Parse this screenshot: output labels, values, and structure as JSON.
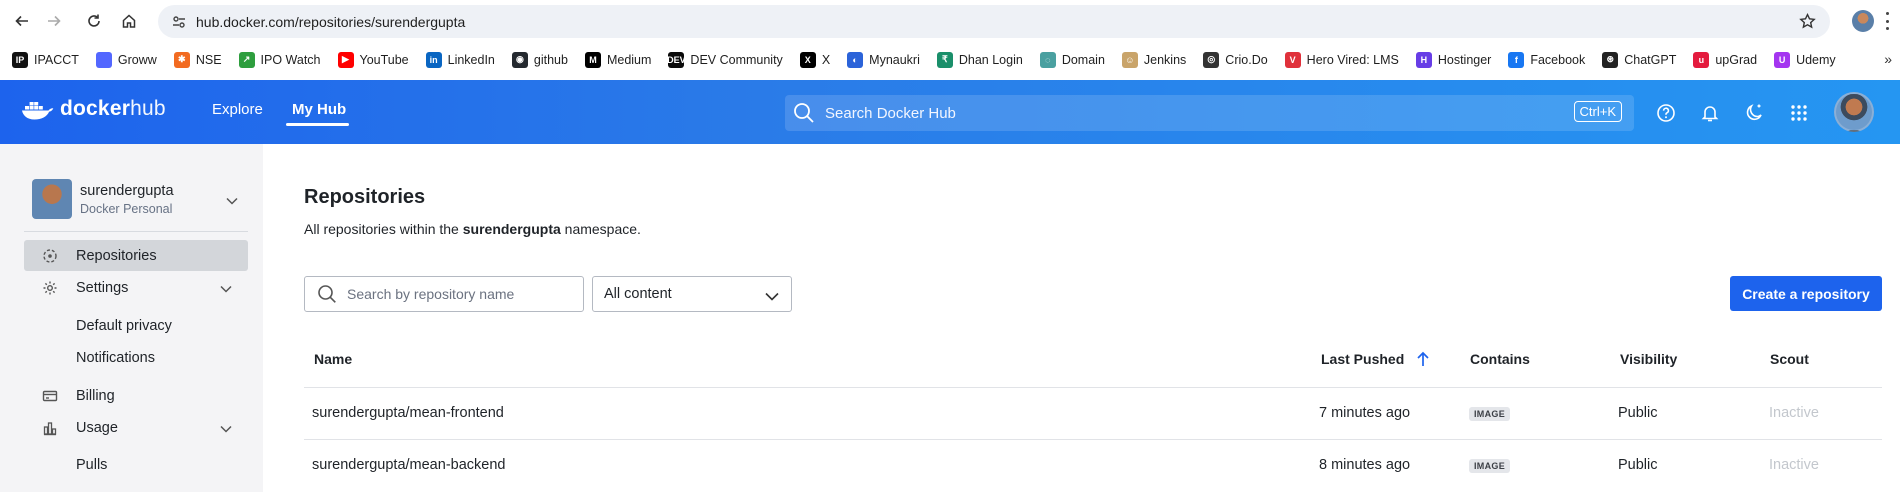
{
  "browser": {
    "url": "hub.docker.com/repositories/surendergupta",
    "bookmarks": [
      {
        "label": "IPACCT",
        "color": "#111111",
        "glyph": "IP"
      },
      {
        "label": "Groww",
        "color": "#5367ff",
        "glyph": ""
      },
      {
        "label": "NSE",
        "color": "#f26b21",
        "glyph": "✱"
      },
      {
        "label": "IPO Watch",
        "color": "#2e9e3e",
        "glyph": "↗"
      },
      {
        "label": "YouTube",
        "color": "#ff0000",
        "glyph": "▶"
      },
      {
        "label": "LinkedIn",
        "color": "#0a66c2",
        "glyph": "in"
      },
      {
        "label": "github",
        "color": "#24292f",
        "glyph": "◉"
      },
      {
        "label": "Medium",
        "color": "#000000",
        "glyph": "M"
      },
      {
        "label": "DEV Community",
        "color": "#0a0a0a",
        "glyph": "DEV"
      },
      {
        "label": "X",
        "color": "#000000",
        "glyph": "X"
      },
      {
        "label": "Mynaukri",
        "color": "#2b63d9",
        "glyph": "◐"
      },
      {
        "label": "Dhan Login",
        "color": "#1a8f6a",
        "glyph": "₹"
      },
      {
        "label": "Domain",
        "color": "#4aa0a0",
        "glyph": "◌"
      },
      {
        "label": "Jenkins",
        "color": "#c9a46a",
        "glyph": "☺"
      },
      {
        "label": "Crio.Do",
        "color": "#333333",
        "glyph": "◎"
      },
      {
        "label": "Hero Vired: LMS",
        "color": "#e0313b",
        "glyph": "V"
      },
      {
        "label": "Hostinger",
        "color": "#673de6",
        "glyph": "H"
      },
      {
        "label": "Facebook",
        "color": "#1877f2",
        "glyph": "f"
      },
      {
        "label": "ChatGPT",
        "color": "#222222",
        "glyph": "⊛"
      },
      {
        "label": "upGrad",
        "color": "#e41b3e",
        "glyph": "u"
      },
      {
        "label": "Udemy",
        "color": "#a435f0",
        "glyph": "U"
      }
    ]
  },
  "header": {
    "logo_bold": "docker",
    "logo_light": "hub",
    "nav": {
      "explore": "Explore",
      "myhub": "My Hub"
    },
    "search_placeholder": "Search Docker Hub",
    "shortcut": "Ctrl+K"
  },
  "sidebar": {
    "account_name": "surendergupta",
    "account_type": "Docker Personal",
    "items": {
      "repositories": "Repositories",
      "settings": "Settings",
      "default_privacy": "Default privacy",
      "notifications": "Notifications",
      "billing": "Billing",
      "usage": "Usage",
      "pulls": "Pulls"
    }
  },
  "main": {
    "title": "Repositories",
    "desc_prefix": "All repositories within the ",
    "namespace": "surendergupta",
    "desc_suffix": " namespace.",
    "search_placeholder": "Search by repository name",
    "filter_value": "All content",
    "create_button": "Create a repository",
    "columns": {
      "name": "Name",
      "last_pushed": "Last Pushed",
      "contains": "Contains",
      "visibility": "Visibility",
      "scout": "Scout"
    },
    "rows": [
      {
        "name": "surendergupta/mean-frontend",
        "last_pushed": "7 minutes ago",
        "contains": "IMAGE",
        "visibility": "Public",
        "scout": "Inactive"
      },
      {
        "name": "surendergupta/mean-backend",
        "last_pushed": "8 minutes ago",
        "contains": "IMAGE",
        "visibility": "Public",
        "scout": "Inactive"
      }
    ]
  }
}
